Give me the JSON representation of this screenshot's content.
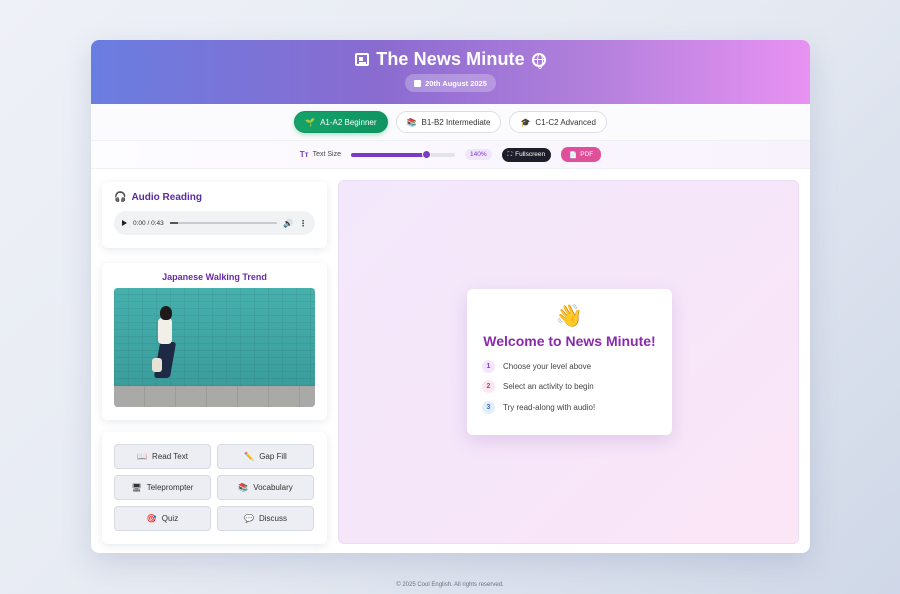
{
  "header": {
    "title": "The News Minute",
    "date": "20th August 2025",
    "icons": {
      "left": "newspaper-icon",
      "right": "globe-icon",
      "date": "calendar-icon"
    }
  },
  "levels": [
    {
      "label": "A1-A2 Beginner",
      "icon": "sprout-icon",
      "active": true
    },
    {
      "label": "B1-B2 Intermediate",
      "icon": "books-icon",
      "active": false
    },
    {
      "label": "C1-C2 Advanced",
      "icon": "graduation-cap-icon",
      "active": false
    }
  ],
  "toolbar": {
    "text_size_label": "Text Size",
    "text_size_value": "140%",
    "text_size_fraction": 0.73,
    "fullscreen_label": "Fullscreen",
    "pdf_label": "PDF"
  },
  "audio": {
    "title": "Audio Reading",
    "time": "0:00 / 0:43"
  },
  "article": {
    "title": "Japanese Walking Trend"
  },
  "actions": [
    {
      "label": "Read Text",
      "icon": "book-icon"
    },
    {
      "label": "Gap Fill",
      "icon": "pencil-icon"
    },
    {
      "label": "Teleprompter",
      "icon": "monitor-icon"
    },
    {
      "label": "Vocabulary",
      "icon": "books-icon"
    },
    {
      "label": "Quiz",
      "icon": "target-icon"
    },
    {
      "label": "Discuss",
      "icon": "speech-bubble-icon"
    }
  ],
  "welcome": {
    "emoji": "👋",
    "title": "Welcome to News Minute!",
    "steps": [
      {
        "num": "1",
        "text": "Choose your level above"
      },
      {
        "num": "2",
        "text": "Select an activity to begin"
      },
      {
        "num": "3",
        "text": "Try read-along with audio!"
      }
    ]
  },
  "footer": "© 2025 Cool English. All rights reserved.",
  "colors": {
    "accent": "#7b3bc4",
    "beginner_active": "#0e9460",
    "pdf": "#e0509a",
    "fullscreen": "#1e1e2a"
  }
}
